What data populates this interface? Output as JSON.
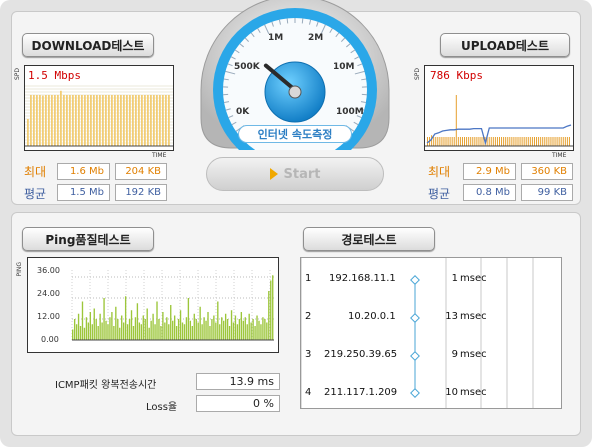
{
  "download": {
    "title": "DOWNLOAD테스트",
    "rate_text": "1.5 Mbps",
    "y_axis": "SPD",
    "x_axis": "TIME",
    "max_label": "최대",
    "avg_label": "평균",
    "max_mb": "1.6 Mb",
    "max_kb": "204 KB",
    "avg_mb": "1.5 Mb",
    "avg_kb": "192 KB",
    "bars": [
      0.45,
      0.85,
      0.85,
      0.85,
      0.85,
      0.84,
      0.85,
      0.85,
      0.85,
      0.85,
      0.85,
      0.92,
      0.85,
      0.85,
      0.85,
      0.85,
      0.85,
      0.85,
      0.85,
      0.85,
      0.85,
      0.85,
      0.85,
      0.85,
      0.85,
      0.85,
      0.85,
      0.85,
      0.85,
      0.85,
      0.85,
      0.85,
      0.85,
      0.85,
      0.85,
      0.85,
      0.85,
      0.85,
      0.85,
      0.85,
      0.85,
      0.85,
      0.85,
      0.85,
      0.85,
      0.85,
      0.85,
      0.85
    ]
  },
  "upload": {
    "title": "UPLOAD테스트",
    "rate_text": "786 Kbps",
    "y_axis": "SPD",
    "x_axis": "TIME",
    "max_label": "최대",
    "avg_label": "평균",
    "max_mb": "2.9 Mb",
    "max_kb": "360 KB",
    "avg_mb": "0.8 Mb",
    "avg_kb": "99 KB",
    "bars": [
      0.15,
      0.15,
      0.18,
      0.15,
      0.15,
      0.15,
      0.15,
      0.15,
      0.15,
      0.15,
      0.15,
      0.15,
      0.15,
      0.15,
      0.85,
      0.15,
      0.15,
      0.15,
      0.15,
      0.15,
      0.15,
      0.15,
      0.15,
      0.15,
      0.15,
      0.15,
      0.15,
      0.15,
      0.15,
      0.15,
      0.15,
      0.15,
      0.15,
      0.15,
      0.15,
      0.15,
      0.15,
      0.15,
      0.15,
      0.15,
      0.15,
      0.15,
      0.15,
      0.15,
      0.15,
      0.15,
      0.15,
      0.15,
      0.15,
      0.15,
      0.15,
      0.15,
      0.15,
      0.15,
      0.15,
      0.15,
      0.15,
      0.15,
      0.15,
      0.15,
      0.15,
      0.15,
      0.15,
      0.15,
      0.15,
      0.15,
      0.15,
      0.15,
      0.15,
      0.15
    ],
    "line": [
      0.05,
      0.1,
      0.2,
      0.22,
      0.25,
      0.26,
      0.27,
      0.27,
      0.28,
      0.28,
      0.28,
      0.28,
      0.29,
      0.29,
      0.29,
      0.05,
      0.3,
      0.3,
      0.3,
      0.3,
      0.3,
      0.3,
      0.3,
      0.3,
      0.3,
      0.3,
      0.3,
      0.3,
      0.3,
      0.3,
      0.3,
      0.3,
      0.3,
      0.3,
      0.3,
      0.3,
      0.33,
      0.35
    ]
  },
  "gauge": {
    "labels": [
      "0K",
      "500K",
      "1M",
      "2M",
      "10M",
      "100M"
    ],
    "value_fraction": 0.3,
    "caption": "인터넷 속도측정",
    "colors": {
      "ring": "#2aa7e8",
      "hub": "#1d8fd6"
    }
  },
  "start": {
    "label": "Start"
  },
  "ping": {
    "title": "Ping품질테스트",
    "y_axis": "PING",
    "y_ticks": [
      "36.00",
      "24.00",
      "12.00",
      "0.00"
    ],
    "y_max": 40,
    "rtt_label": "ICMP패킷 왕복전송시간",
    "rtt_value": "13.9 ms",
    "loss_label": "Loss율",
    "loss_value": "0 %",
    "values": [
      6,
      12,
      9,
      15,
      8,
      22,
      7,
      13,
      10,
      16,
      9,
      18,
      12,
      8,
      15,
      10,
      24,
      11,
      9,
      13,
      16,
      8,
      19,
      12,
      7,
      14,
      10,
      25,
      9,
      12,
      17,
      8,
      13,
      21,
      10,
      9,
      14,
      12,
      18,
      7,
      11,
      15,
      9,
      22,
      12,
      8,
      16,
      10,
      13,
      9,
      20,
      11,
      14,
      8,
      12,
      17,
      10,
      9,
      13,
      24,
      11,
      8,
      15,
      12,
      10,
      19,
      9,
      13,
      11,
      16,
      8,
      12,
      14,
      10,
      22,
      9,
      13,
      11,
      15,
      12,
      8,
      17,
      10,
      14,
      9,
      12,
      16,
      11,
      13,
      9,
      15,
      10,
      12,
      8,
      14,
      11,
      9,
      13,
      12,
      10,
      28,
      34,
      37
    ]
  },
  "route": {
    "title": "경로테스트",
    "unit": "msec",
    "hops": [
      {
        "n": "1",
        "ip": "192.168.11.1",
        "ms": "1"
      },
      {
        "n": "2",
        "ip": "10.20.0.1",
        "ms": "13"
      },
      {
        "n": "3",
        "ip": "219.250.39.65",
        "ms": "9"
      },
      {
        "n": "4",
        "ip": "211.117.1.209",
        "ms": "10"
      }
    ]
  }
}
